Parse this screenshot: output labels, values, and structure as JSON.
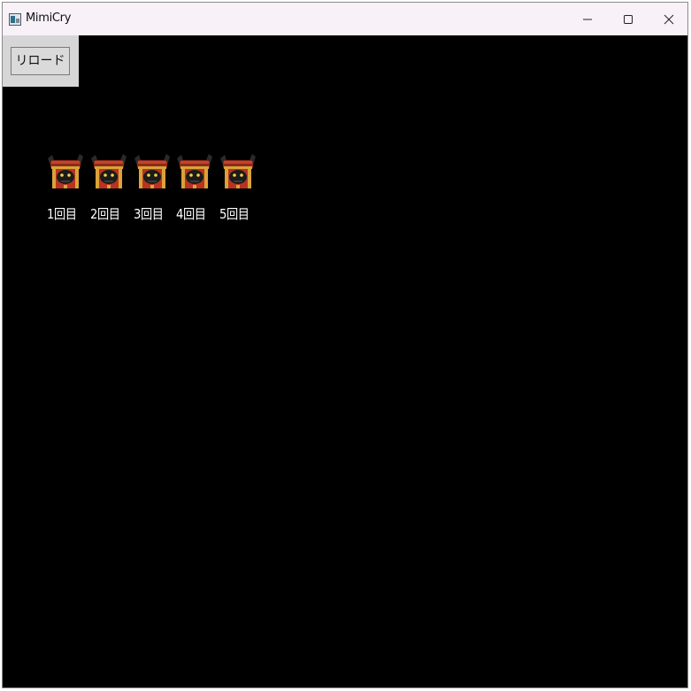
{
  "window": {
    "title": "MimiCry",
    "icon": "app-window-icon"
  },
  "titlebar_controls": {
    "minimize_icon": "minimize-icon",
    "maximize_icon": "maximize-icon",
    "close_icon": "close-icon"
  },
  "toolbar": {
    "reload_label": "リロード"
  },
  "tries": [
    {
      "label": "1回目",
      "icon": "mimic-chest-icon"
    },
    {
      "label": "2回目",
      "icon": "mimic-chest-icon"
    },
    {
      "label": "3回目",
      "icon": "mimic-chest-icon"
    },
    {
      "label": "4回目",
      "icon": "mimic-chest-icon"
    },
    {
      "label": "5回目",
      "icon": "mimic-chest-icon"
    }
  ],
  "colors": {
    "background": "#000000",
    "titlebar": "#f8f1f8",
    "panel": "#d6d6d6",
    "chest_red": "#b8341f",
    "chest_gold": "#d9a23a",
    "label_text": "#ffffff"
  }
}
